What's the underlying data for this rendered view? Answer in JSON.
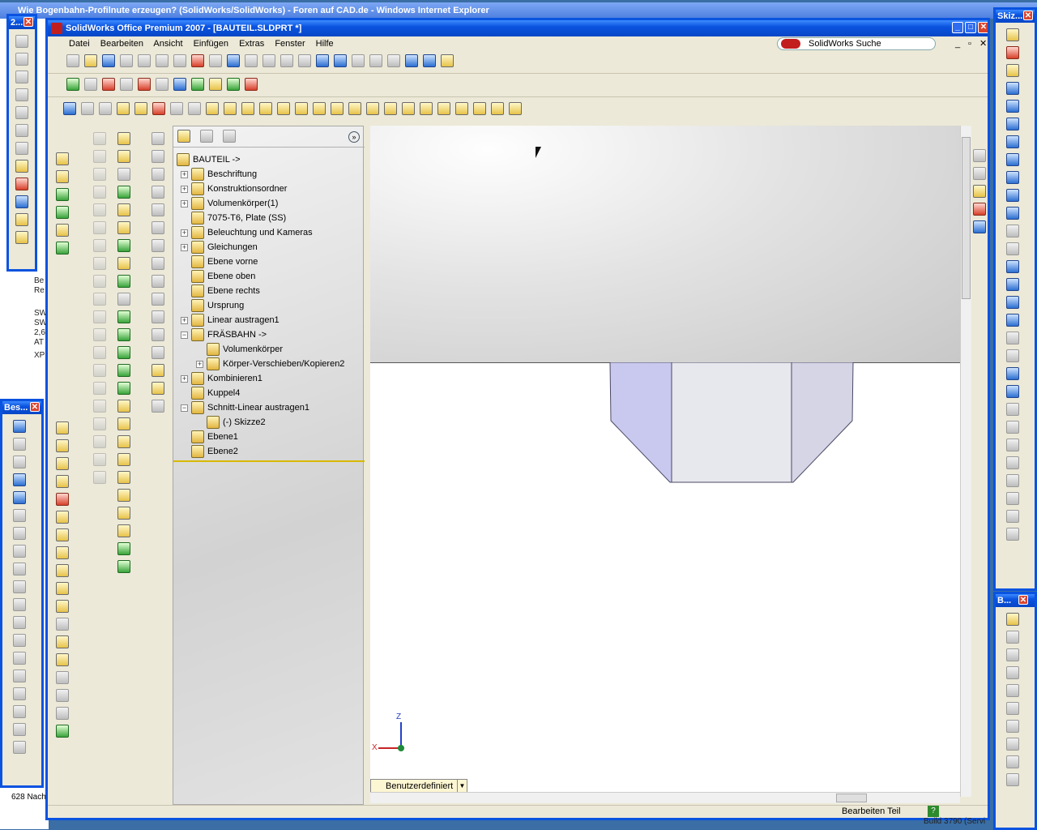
{
  "ie_window": {
    "title": "Wie Bogenbahn-Profilnute erzeugen? (SolidWorks/SolidWorks) - Foren auf CAD.de - Windows Internet Explorer"
  },
  "bg_fragments": [
    "Be",
    "Re",
    "SW",
    "SW",
    "2,6",
    "AT",
    "XP",
    "628 Nach"
  ],
  "sw_window": {
    "title": "SolidWorks Office Premium 2007 - [BAUTEIL.SLDPRT *]"
  },
  "menu": {
    "items": [
      "Datei",
      "Bearbeiten",
      "Ansicht",
      "Einfügen",
      "Extras",
      "Fenster",
      "Hilfe"
    ]
  },
  "search": {
    "label": "SolidWorks Suche"
  },
  "toolbars": {
    "float1_title": "2...",
    "float2_title": "Bes...",
    "float3_title": "Skiz...",
    "float4_title": "B..."
  },
  "tree": {
    "root": "BAUTEIL ->",
    "items": [
      {
        "label": "Beschriftung",
        "exp": "+"
      },
      {
        "label": "Konstruktionsordner",
        "exp": "+"
      },
      {
        "label": "Volumenkörper(1)",
        "exp": "+"
      },
      {
        "label": "7075-T6, Plate (SS)",
        "exp": ""
      },
      {
        "label": "Beleuchtung und Kameras",
        "exp": "+"
      },
      {
        "label": "Gleichungen",
        "exp": "+"
      },
      {
        "label": "Ebene vorne",
        "exp": ""
      },
      {
        "label": "Ebene oben",
        "exp": ""
      },
      {
        "label": "Ebene rechts",
        "exp": ""
      },
      {
        "label": "Ursprung",
        "exp": ""
      },
      {
        "label": "Linear austragen1",
        "exp": "+"
      },
      {
        "label": "FRÄSBAHN ->",
        "exp": "−"
      },
      {
        "label": "Volumenkörper",
        "exp": ""
      },
      {
        "label": "Körper-Verschieben/Kopieren2",
        "exp": "+"
      },
      {
        "label": "Kombinieren1",
        "exp": "+"
      },
      {
        "label": "Kuppel4",
        "exp": ""
      },
      {
        "label": "Schnitt-Linear austragen1",
        "exp": "−"
      },
      {
        "label": "(-) Skizze2",
        "exp": ""
      },
      {
        "label": "Ebene1",
        "exp": ""
      },
      {
        "label": "Ebene2",
        "exp": ""
      }
    ]
  },
  "viewport": {
    "axis_x": "X",
    "axis_z": "Z",
    "view_label": "Benutzerdefiniert"
  },
  "status": {
    "mode": "Bearbeiten Teil",
    "help": "?",
    "build": "Build 3790 (Servi"
  }
}
